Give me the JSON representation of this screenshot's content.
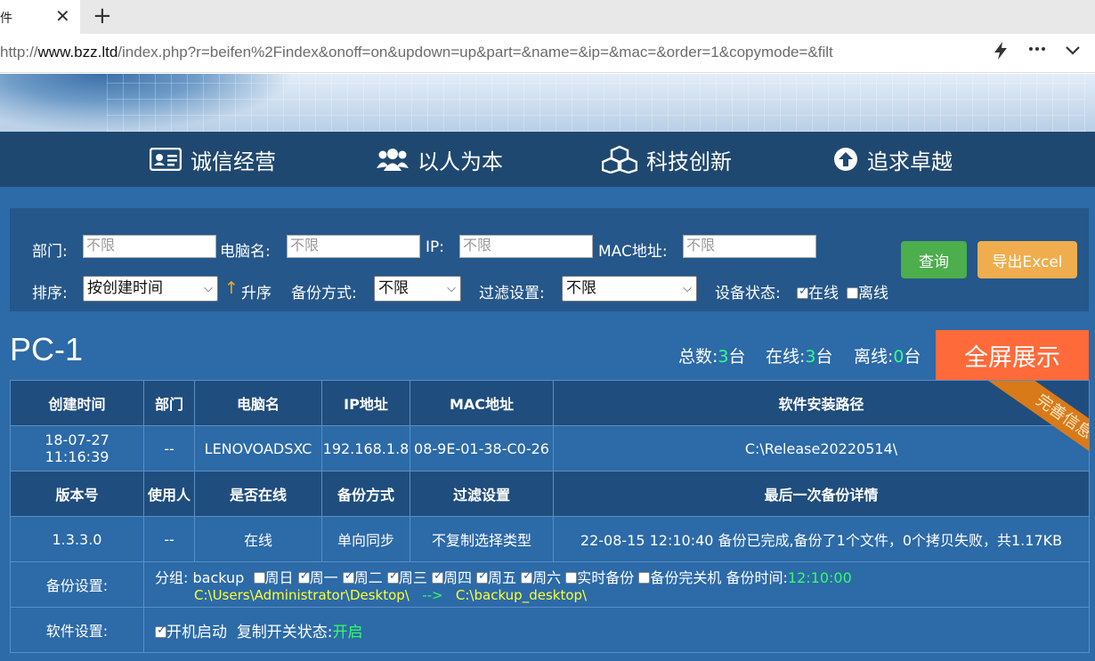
{
  "browser": {
    "tab_title": "件",
    "tab_close": "✕",
    "new_tab": "+",
    "url_prefix": "http://",
    "url_host": "www.bzz.ltd",
    "url_rest": "/index.php?r=beifen%2Findex&onoff=on&updown=up&part=&name=&ip=&mac=&order=1&copymode=&filt",
    "icons": [
      "lightning-icon",
      "more-icon",
      "chevron-down-icon"
    ]
  },
  "nav": {
    "items": [
      {
        "label": "诚信经营",
        "icon": "id-card-icon"
      },
      {
        "label": "以人为本",
        "icon": "users-icon"
      },
      {
        "label": "科技创新",
        "icon": "cubes-icon"
      },
      {
        "label": "追求卓越",
        "icon": "arrow-up-circle-icon"
      }
    ]
  },
  "filter": {
    "dept_label": "部门:",
    "dept_placeholder": "不限",
    "pcname_label": "电脑名:",
    "pcname_placeholder": "不限",
    "ip_label": "IP:",
    "ip_placeholder": "不限",
    "mac_label": "MAC地址:",
    "mac_placeholder": "不限",
    "sort_label": "排序:",
    "sort_value": "按创建时间",
    "order_arrow": "↑",
    "order_label": "升序",
    "backup_label": "备份方式:",
    "backup_value": "不限",
    "filter_label": "过滤设置:",
    "filter_value": "不限",
    "status_label": "设备状态:",
    "online_label": "在线",
    "online_checked": true,
    "offline_label": "离线",
    "offline_checked": false,
    "query_button": "查询",
    "export_button": "导出Excel",
    "colors": {
      "query": "#4cae4c",
      "export": "#f0ad4e"
    }
  },
  "summary": {
    "pc_title": "PC-1",
    "total_label": "总数:",
    "total_value": "3",
    "total_unit": "台",
    "online_label": "在线:",
    "online_value": "3",
    "online_unit": "台",
    "offline_label": "离线:",
    "offline_value": "0",
    "offline_unit": "台",
    "fullscreen_button": "全屏展示",
    "ribbon": "完善信息"
  },
  "table": {
    "header1": [
      "创建时间",
      "部门",
      "电脑名",
      "IP地址",
      "MAC地址",
      "软件安装路径"
    ],
    "row1": [
      "18-07-27 11:16:39",
      "--",
      "LENOVOADSXC",
      "192.168.1.8",
      "08-9E-01-38-C0-26",
      "C:\\Release20220514\\"
    ],
    "header2": [
      "版本号",
      "使用人",
      "是否在线",
      "备份方式",
      "过滤设置",
      "最后一次备份详情"
    ],
    "row2": [
      "1.3.3.0",
      "--",
      "在线",
      "单向同步",
      "不复制选择类型",
      "22-08-15 12:10:40 备份已完成,备份了1个文件，0个拷贝失败，共1.17KB"
    ],
    "backup_settings_label": "备份设置:",
    "group_label": "分组:",
    "group_value": "backup",
    "days": [
      {
        "label": "周日",
        "checked": false
      },
      {
        "label": "周一",
        "checked": true
      },
      {
        "label": "周二",
        "checked": true
      },
      {
        "label": "周三",
        "checked": true
      },
      {
        "label": "周四",
        "checked": true
      },
      {
        "label": "周五",
        "checked": true
      },
      {
        "label": "周六",
        "checked": true
      },
      {
        "label": "实时备份",
        "checked": false
      },
      {
        "label": "备份完关机",
        "checked": false
      }
    ],
    "backup_time_label": "备份时间:",
    "backup_time_value": "12:10:00",
    "source_path": "C:\\Users\\Administrator\\Desktop\\",
    "path_arrow": "-->",
    "dest_path": "C:\\backup_desktop\\",
    "software_settings_label": "软件设置:",
    "autostart_label": "开机启动",
    "autostart_checked": true,
    "copy_switch_label": "复制开关状态:",
    "copy_switch_value": "开启"
  }
}
